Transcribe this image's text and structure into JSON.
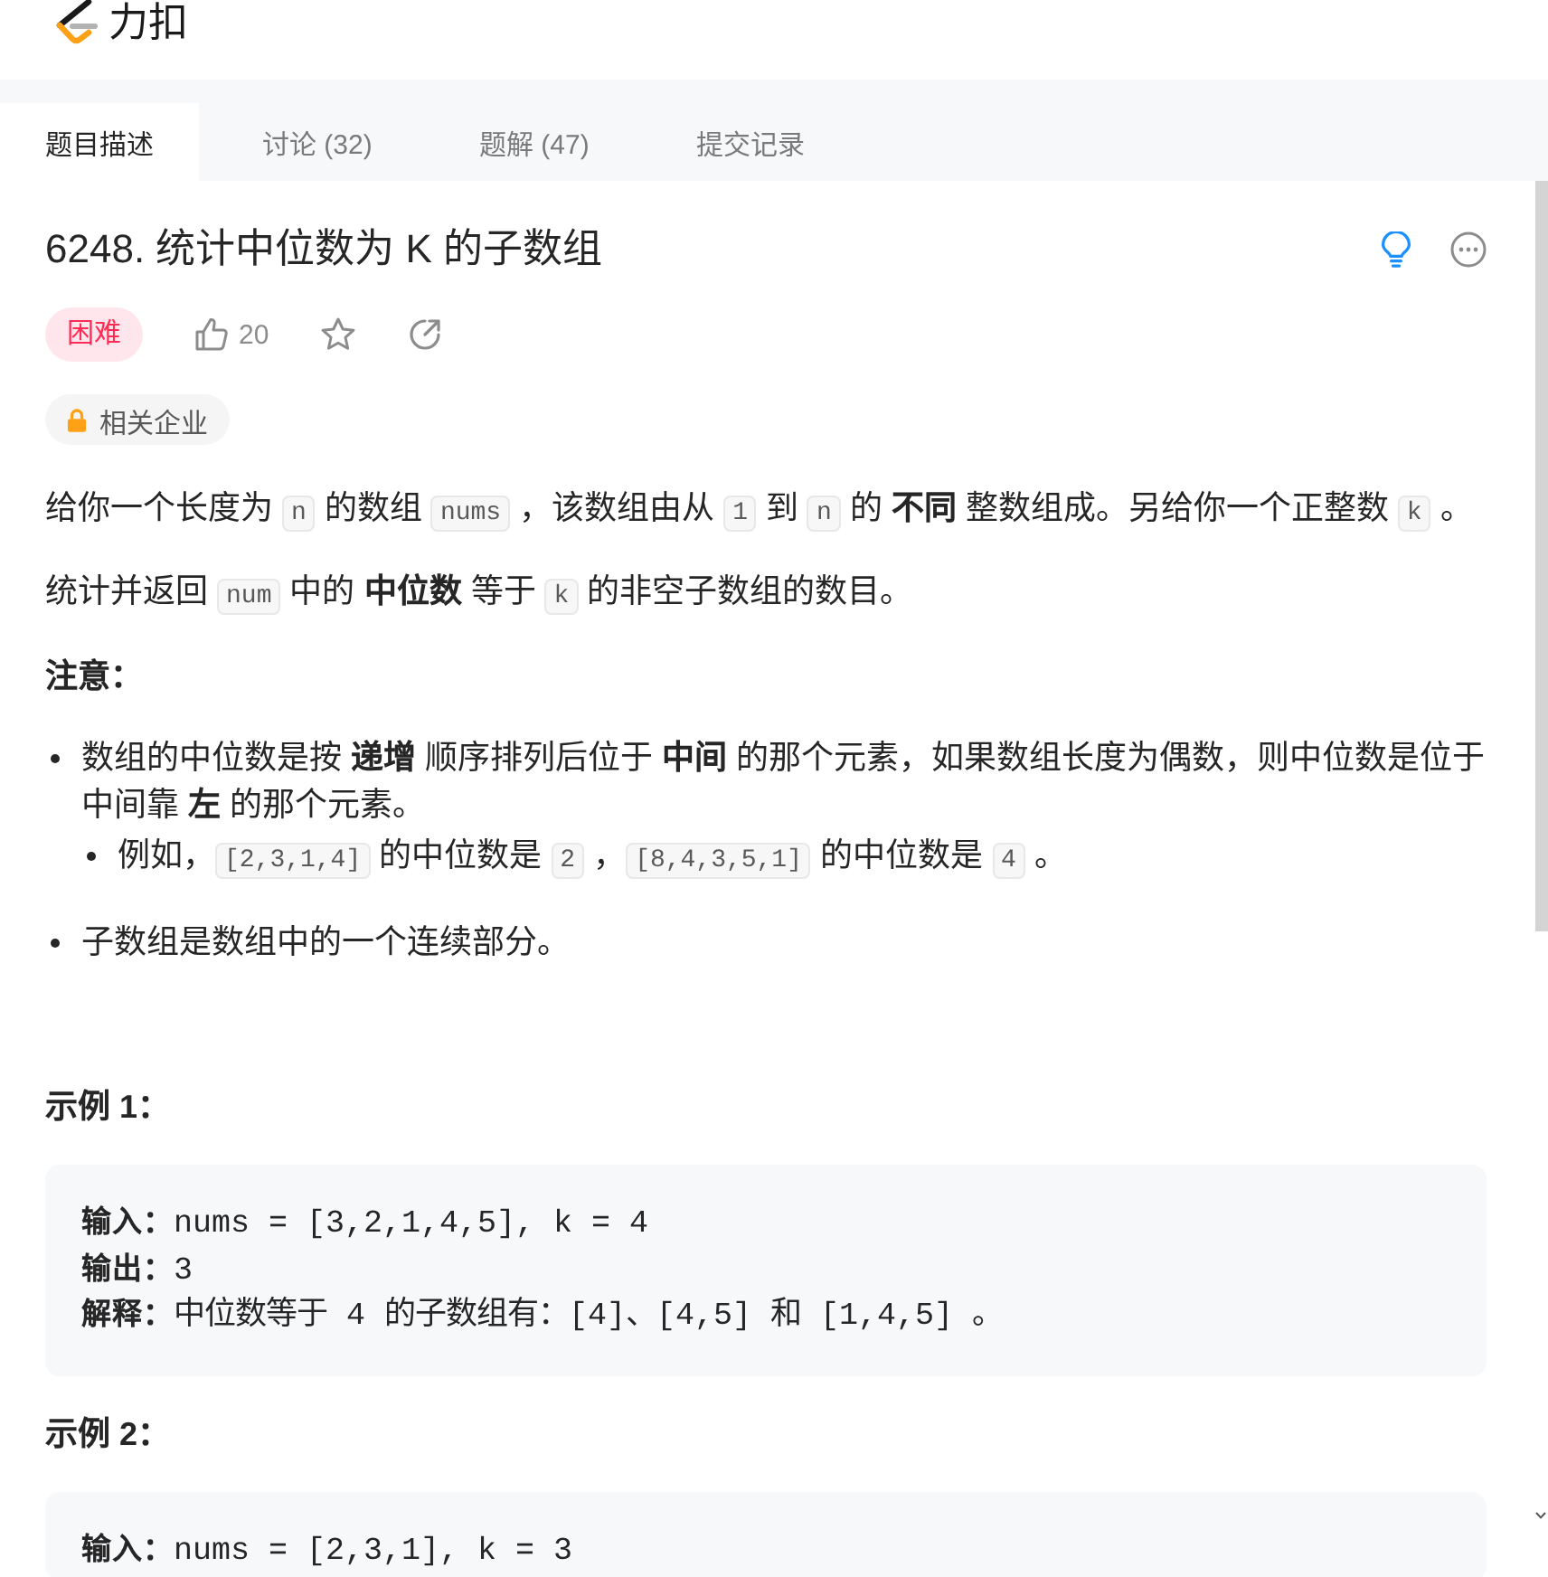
{
  "header": {
    "logo_text": "力扣"
  },
  "tabs": [
    {
      "label": "题目描述",
      "selected": true
    },
    {
      "label": "讨论 (32)",
      "selected": false
    },
    {
      "label": "题解 (47)",
      "selected": false
    },
    {
      "label": "提交记录",
      "selected": false
    }
  ],
  "problem": {
    "title": "6248. 统计中位数为 K 的子数组",
    "difficulty": {
      "label": "困难",
      "kind": "hard"
    },
    "likes": "20",
    "companies_tag": "相关企业"
  },
  "description": [
    {
      "segments": [
        {
          "kind": "text",
          "text": "给你一个长度为 "
        },
        {
          "kind": "code",
          "text": "n"
        },
        {
          "kind": "text",
          "text": " 的数组 "
        },
        {
          "kind": "code",
          "text": "nums"
        },
        {
          "kind": "text",
          "text": " ，该数组由从 "
        },
        {
          "kind": "code",
          "text": "1"
        },
        {
          "kind": "text",
          "text": " 到 "
        },
        {
          "kind": "code",
          "text": "n"
        },
        {
          "kind": "text",
          "text": " 的 "
        },
        {
          "kind": "bold",
          "text": "不同"
        },
        {
          "kind": "text",
          "text": " 整数组成。另给你一个正整数 "
        },
        {
          "kind": "code",
          "text": "k"
        },
        {
          "kind": "text",
          "text": " 。"
        }
      ]
    },
    {
      "segments": [
        {
          "kind": "text",
          "text": "统计并返回 "
        },
        {
          "kind": "code",
          "text": "num"
        },
        {
          "kind": "text",
          "text": " 中的 "
        },
        {
          "kind": "bold",
          "text": "中位数"
        },
        {
          "kind": "text",
          "text": " 等于 "
        },
        {
          "kind": "code",
          "text": "k"
        },
        {
          "kind": "text",
          "text": " 的非空子数组的数目。"
        }
      ]
    }
  ],
  "notes": {
    "heading": "注意：",
    "items": [
      {
        "segments": [
          {
            "kind": "text",
            "text": "数组的中位数是按 "
          },
          {
            "kind": "bold",
            "text": "递增"
          },
          {
            "kind": "text",
            "text": " 顺序排列后位于 "
          },
          {
            "kind": "bold",
            "text": "中间"
          },
          {
            "kind": "text",
            "text": " 的那个元素，如果数组长度为偶数，则中位数是位于中间靠 "
          },
          {
            "kind": "bold",
            "text": "左"
          },
          {
            "kind": "text",
            "text": " 的那个元素。"
          }
        ],
        "children": [
          {
            "segments": [
              {
                "kind": "text",
                "text": "例如，"
              },
              {
                "kind": "code",
                "text": "[2,3,1,4]"
              },
              {
                "kind": "text",
                "text": " 的中位数是 "
              },
              {
                "kind": "code",
                "text": "2"
              },
              {
                "kind": "text",
                "text": " ，"
              },
              {
                "kind": "code",
                "text": "[8,4,3,5,1]"
              },
              {
                "kind": "text",
                "text": " 的中位数是 "
              },
              {
                "kind": "code",
                "text": "4"
              },
              {
                "kind": "text",
                "text": " 。"
              }
            ]
          }
        ]
      },
      {
        "segments": [
          {
            "kind": "text",
            "text": "子数组是数组中的一个连续部分。"
          }
        ]
      }
    ]
  },
  "examples": [
    {
      "heading": "示例 1：",
      "lines": [
        {
          "label": "输入：",
          "value": "nums = [3,2,1,4,5], k = 4"
        },
        {
          "label": "输出：",
          "value": "3"
        },
        {
          "label": "解释：",
          "value": "中位数等于 4 的子数组有：[4]、[4,5] 和 [1,4,5] 。"
        }
      ]
    },
    {
      "heading": "示例 2：",
      "lines": [
        {
          "label": "输入：",
          "value": "nums = [2,3,1], k = 3"
        }
      ]
    }
  ]
}
